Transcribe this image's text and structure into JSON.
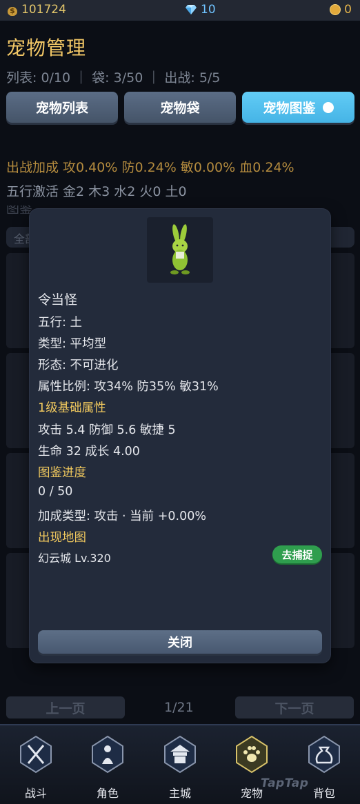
{
  "currency": {
    "gold": "101724",
    "gems": "10",
    "coins": "0"
  },
  "page": {
    "title": "宠物管理",
    "stats": "列表: 0/10 ｜ 袋: 3/50 ｜ 出战: 5/5"
  },
  "tabs": [
    {
      "label": "宠物列表"
    },
    {
      "label": "宠物袋"
    },
    {
      "label": "宠物图鉴",
      "active": true
    }
  ],
  "bonus": {
    "battle": "出战加成 攻0.40% 防0.24% 敏0.00% 血0.24%",
    "five_elements": "五行激活 金2 木3 水2 火0 土0",
    "codex_partial": "图鉴",
    "filter_partial": "全部"
  },
  "pager": {
    "prev": "上一页",
    "page": "1/21",
    "next": "下一页"
  },
  "modal": {
    "name": "令当怪",
    "element": "五行: 土",
    "type": "类型: 平均型",
    "form": "形态: 不可进化",
    "ratio": "属性比例: 攻34% 防35% 敏31%",
    "base_title": "1级基础属性",
    "base_line1": "攻击 5.4  防御 5.6  敏捷 5",
    "base_line2": "生命 32  成长 4.00",
    "progress_title": "图鉴进度",
    "progress_value": "0 / 50",
    "bonus_line": "加成类型: 攻击  ·  当前 +0.00%",
    "map_title": "出现地图",
    "map_value": "幻云城  Lv.320",
    "capture_button": "去捕捉",
    "close_button": "关闭"
  },
  "nav": [
    {
      "label": "战斗",
      "icon": "crossed-swords-icon"
    },
    {
      "label": "角色",
      "icon": "character-icon"
    },
    {
      "label": "主城",
      "icon": "castle-icon"
    },
    {
      "label": "宠物",
      "icon": "paw-icon",
      "active": true
    },
    {
      "label": "背包",
      "icon": "bag-icon"
    }
  ],
  "watermark": "TapTap",
  "colors": {
    "accent_gold": "#f1c95e",
    "tab_active": "#45b4e6",
    "capture_green": "#2f9e4e"
  }
}
